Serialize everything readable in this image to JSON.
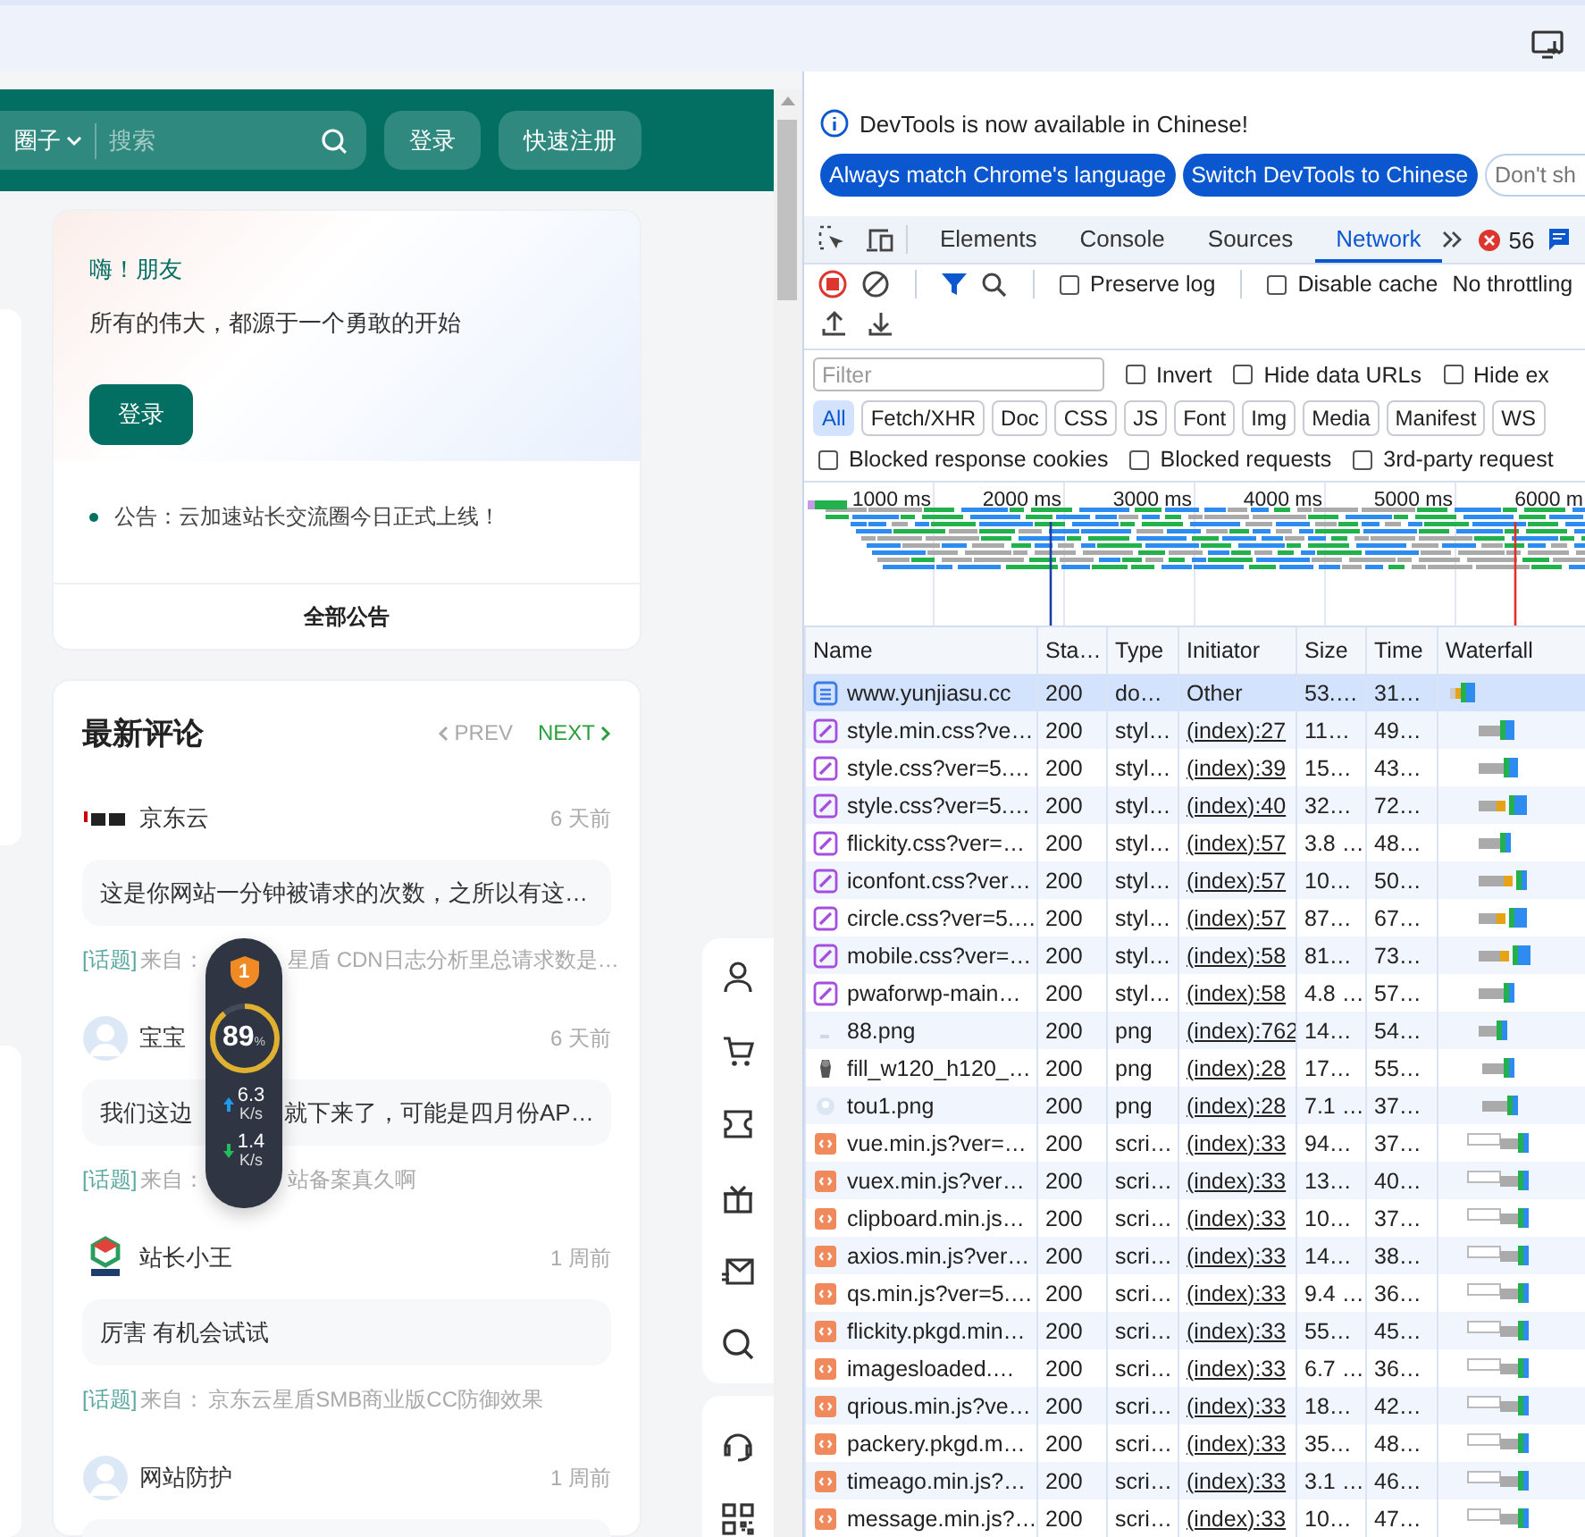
{
  "site": {
    "header": {
      "category": "圈子",
      "search_placeholder": "搜索",
      "buttons": [
        "登录",
        "快速注册"
      ]
    },
    "welcome_card": {
      "greeting": "嗨！朋友",
      "tagline": "所有的伟大，都源于一个勇敢的开始",
      "login_button": "登录",
      "notice": "公告：云加速站长交流圈今日正式上线！",
      "all_notices": "全部公告"
    },
    "comments": {
      "title": "最新评论",
      "pager": [
        {
          "label": "PREV",
          "disabled": true
        },
        {
          "label": "NEXT",
          "disabled": false
        }
      ],
      "items": [
        {
          "kind": "brand",
          "name": "京东云",
          "time": "6 天前",
          "text": "这是你网站一分钟被请求的次数，之所以有这…",
          "tag": "[话题]",
          "from": "来自：",
          "topic_after": "星盾 CDN日志分析里总请求数是…"
        },
        {
          "kind": "default",
          "name": "宝宝",
          "time": "6 天前",
          "text": "我们这边",
          "text_after": "就下来了，可能是四月份AP…",
          "tag": "[话题]",
          "from": "来自：",
          "topic_after": "站备案真久啊"
        },
        {
          "kind": "cube",
          "name": "站长小王",
          "time": "1 周前",
          "text": "厉害 有机会试试",
          "tag": "[话题]",
          "from": "来自：",
          "topic": "京东云星盾SMB商业版CC防御效果"
        },
        {
          "kind": "default",
          "name": "网站防护",
          "time": "1 周前"
        }
      ]
    },
    "speed_widget": {
      "badge": "1",
      "level": 0.89,
      "percent": "89",
      "unit": "%",
      "upload": "6.3",
      "upload_unit": "K/s",
      "download": "1.4",
      "download_unit": "K/s"
    }
  },
  "devtools": {
    "infobar": {
      "message": "DevTools is now available in Chinese!",
      "buttons": [
        {
          "label": "Always match Chrome's language",
          "kind": "primary"
        },
        {
          "label": "Switch DevTools to Chinese",
          "kind": "primary"
        },
        {
          "label": "Don't sh",
          "kind": "outline"
        }
      ]
    },
    "tabs": [
      {
        "label": "Elements",
        "selected": false
      },
      {
        "label": "Console",
        "selected": false
      },
      {
        "label": "Sources",
        "selected": false
      },
      {
        "label": "Network",
        "selected": true
      }
    ],
    "error_count": "56",
    "recording": true,
    "checks": [
      {
        "label": "Preserve log",
        "checked": false
      },
      {
        "label": "Disable cache",
        "checked": false
      }
    ],
    "throttling": "No throttling",
    "filter": {
      "placeholder": "Filter"
    },
    "filter_options": [
      {
        "label": "Invert",
        "checked": false
      },
      {
        "label": "Hide data URLs",
        "checked": false
      },
      {
        "label": "Hide ex",
        "checked": false
      }
    ],
    "type_filters": [
      {
        "label": "All",
        "selected": true
      },
      {
        "label": "Fetch/XHR",
        "selected": false
      },
      {
        "label": "Doc",
        "selected": false
      },
      {
        "label": "CSS",
        "selected": false
      },
      {
        "label": "JS",
        "selected": false
      },
      {
        "label": "Font",
        "selected": false
      },
      {
        "label": "Img",
        "selected": false
      },
      {
        "label": "Media",
        "selected": false
      },
      {
        "label": "Manifest",
        "selected": false
      },
      {
        "label": "WS",
        "selected": false
      }
    ],
    "blocked_options": [
      {
        "label": "Blocked response cookies",
        "checked": false
      },
      {
        "label": "Blocked requests",
        "checked": false
      },
      {
        "label": "3rd-party request",
        "checked": false
      }
    ],
    "overview": {
      "ticks": [
        "1000 ms",
        "2000 ms",
        "3000 ms",
        "4000 ms",
        "5000 ms",
        "6000 m"
      ]
    },
    "table": {
      "columns": [
        "Name",
        "Sta…",
        "Type",
        "Initiator",
        "Size",
        "Time",
        "Waterfall"
      ],
      "rows": [
        {
          "kind": "document",
          "name": "www.yunjiasu.cc",
          "status": "200",
          "type": "do…",
          "initiator": "Other",
          "initiator_link": false,
          "size": "53.…",
          "time": "31…",
          "selected": true
        },
        {
          "kind": "stylesheet",
          "name": "style.min.css?ve…",
          "status": "200",
          "type": "styl…",
          "initiator": "(index):27",
          "initiator_link": true,
          "size": "11…",
          "time": "49…",
          "selected": false
        },
        {
          "kind": "stylesheet",
          "name": "style.css?ver=5.…",
          "status": "200",
          "type": "styl…",
          "initiator": "(index):39",
          "initiator_link": true,
          "size": "15…",
          "time": "43…",
          "selected": false
        },
        {
          "kind": "stylesheet",
          "name": "style.css?ver=5.…",
          "status": "200",
          "type": "styl…",
          "initiator": "(index):40",
          "initiator_link": true,
          "size": "32…",
          "time": "72…",
          "selected": false
        },
        {
          "kind": "stylesheet",
          "name": "flickity.css?ver=…",
          "status": "200",
          "type": "styl…",
          "initiator": "(index):57",
          "initiator_link": true,
          "size": "3.8 …",
          "time": "48…",
          "selected": false
        },
        {
          "kind": "stylesheet",
          "name": "iconfont.css?ver…",
          "status": "200",
          "type": "styl…",
          "initiator": "(index):57",
          "initiator_link": true,
          "size": "10…",
          "time": "50…",
          "selected": false
        },
        {
          "kind": "stylesheet",
          "name": "circle.css?ver=5.…",
          "status": "200",
          "type": "styl…",
          "initiator": "(index):57",
          "initiator_link": true,
          "size": "87…",
          "time": "67…",
          "selected": false
        },
        {
          "kind": "stylesheet",
          "name": "mobile.css?ver=…",
          "status": "200",
          "type": "styl…",
          "initiator": "(index):58",
          "initiator_link": true,
          "size": "81…",
          "time": "73…",
          "selected": false
        },
        {
          "kind": "stylesheet",
          "name": "pwaforwp-main…",
          "status": "200",
          "type": "styl…",
          "initiator": "(index):58",
          "initiator_link": true,
          "size": "4.8 …",
          "time": "57…",
          "selected": false
        },
        {
          "kind": "image",
          "name": "88.png",
          "status": "200",
          "type": "png",
          "initiator": "(index):762",
          "initiator_link": true,
          "size": "14…",
          "time": "54…",
          "selected": false
        },
        {
          "kind": "thumbnail",
          "name": "fill_w120_h120_…",
          "status": "200",
          "type": "png",
          "initiator": "(index):28",
          "initiator_link": true,
          "size": "17…",
          "time": "55…",
          "selected": false
        },
        {
          "kind": "avatar",
          "name": "tou1.png",
          "status": "200",
          "type": "png",
          "initiator": "(index):28",
          "initiator_link": true,
          "size": "7.1 …",
          "time": "37…",
          "selected": false
        },
        {
          "kind": "script",
          "name": "vue.min.js?ver=…",
          "status": "200",
          "type": "scri…",
          "initiator": "(index):33",
          "initiator_link": true,
          "size": "94…",
          "time": "37…",
          "selected": false
        },
        {
          "kind": "script",
          "name": "vuex.min.js?ver…",
          "status": "200",
          "type": "scri…",
          "initiator": "(index):33",
          "initiator_link": true,
          "size": "13…",
          "time": "40…",
          "selected": false
        },
        {
          "kind": "script",
          "name": "clipboard.min.js…",
          "status": "200",
          "type": "scri…",
          "initiator": "(index):33",
          "initiator_link": true,
          "size": "10…",
          "time": "37…",
          "selected": false
        },
        {
          "kind": "script",
          "name": "axios.min.js?ver…",
          "status": "200",
          "type": "scri…",
          "initiator": "(index):33",
          "initiator_link": true,
          "size": "14…",
          "time": "38…",
          "selected": false
        },
        {
          "kind": "script",
          "name": "qs.min.js?ver=5.…",
          "status": "200",
          "type": "scri…",
          "initiator": "(index):33",
          "initiator_link": true,
          "size": "9.4 …",
          "time": "36…",
          "selected": false
        },
        {
          "kind": "script",
          "name": "flickity.pkgd.min…",
          "status": "200",
          "type": "scri…",
          "initiator": "(index):33",
          "initiator_link": true,
          "size": "55…",
          "time": "45…",
          "selected": false
        },
        {
          "kind": "script",
          "name": "imagesloaded.…",
          "status": "200",
          "type": "scri…",
          "initiator": "(index):33",
          "initiator_link": true,
          "size": "6.7 …",
          "time": "36…",
          "selected": false
        },
        {
          "kind": "script",
          "name": "qrious.min.js?ve…",
          "status": "200",
          "type": "scri…",
          "initiator": "(index):33",
          "initiator_link": true,
          "size": "18…",
          "time": "42…",
          "selected": false
        },
        {
          "kind": "script",
          "name": "packery.pkgd.m…",
          "status": "200",
          "type": "scri…",
          "initiator": "(index):33",
          "initiator_link": true,
          "size": "35…",
          "time": "48…",
          "selected": false
        },
        {
          "kind": "script",
          "name": "timeago.min.js?…",
          "status": "200",
          "type": "scri…",
          "initiator": "(index):33",
          "initiator_link": true,
          "size": "3.1 …",
          "time": "46…",
          "selected": false
        },
        {
          "kind": "script",
          "name": "message.min.js?…",
          "status": "200",
          "type": "scri…",
          "initiator": "(index):33",
          "initiator_link": true,
          "size": "10…",
          "time": "47…",
          "selected": false
        }
      ]
    }
  }
}
